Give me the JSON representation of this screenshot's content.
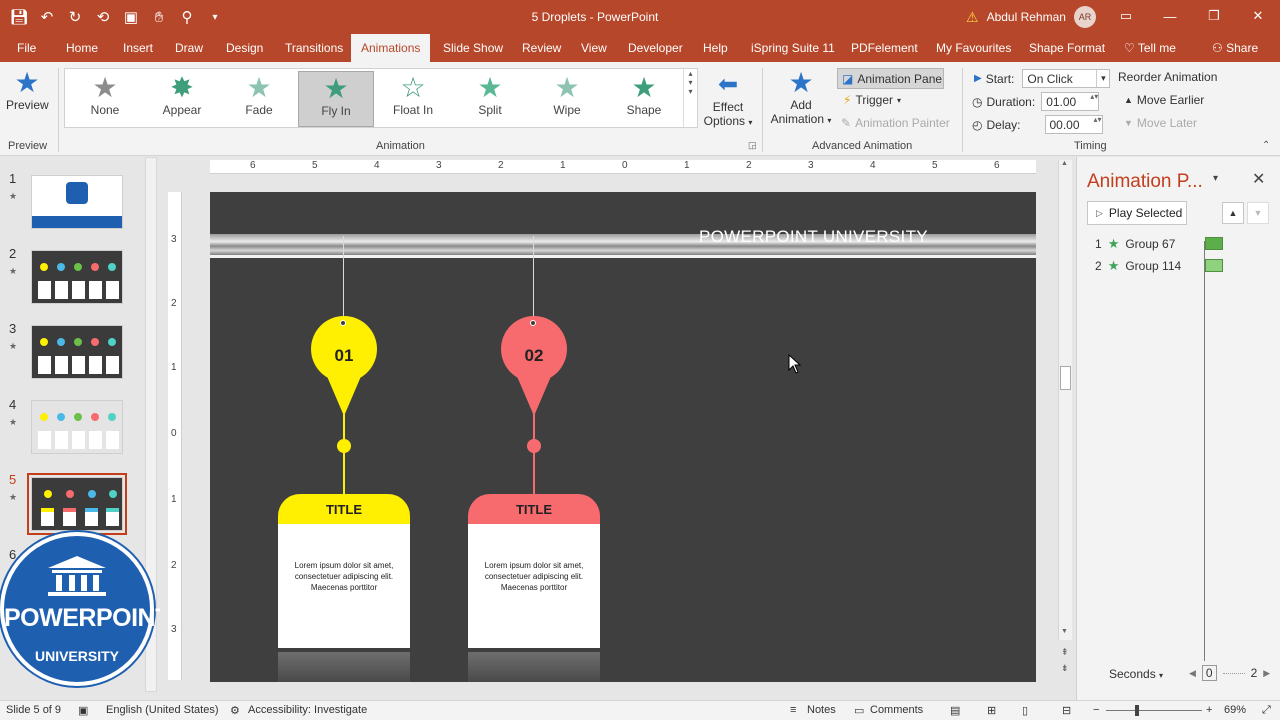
{
  "titlebar": {
    "doc_title": "5 Droplets  -  PowerPoint",
    "user_name": "Abdul Rehman",
    "avatar_initials": "AR"
  },
  "tabs": [
    "File",
    "Home",
    "Insert",
    "Draw",
    "Design",
    "Transitions",
    "Animations",
    "Slide Show",
    "Review",
    "View",
    "Developer",
    "Help",
    "iSpring Suite 11",
    "PDFelement",
    "My Favourites",
    "Shape Format",
    "Tell me",
    "Share"
  ],
  "active_tab": "Animations",
  "ribbon": {
    "preview": {
      "label": "Preview",
      "group": "Preview"
    },
    "animation_gallery": [
      {
        "label": "None",
        "color": "#8c8c8c"
      },
      {
        "label": "Appear",
        "color": "#3e9d7a"
      },
      {
        "label": "Fade",
        "color": "#8cc4b0"
      },
      {
        "label": "Fly In",
        "color": "#3e9d7a"
      },
      {
        "label": "Float In",
        "color": "#3e9d7a"
      },
      {
        "label": "Split",
        "color": "#5ab895"
      },
      {
        "label": "Wipe",
        "color": "#8cc4b0"
      },
      {
        "label": "Shape",
        "color": "#3e9d7a"
      }
    ],
    "selected_animation": "Fly In",
    "effect_options": {
      "line1": "Effect",
      "line2": "Options"
    },
    "animation_group": "Animation",
    "add_animation": {
      "line1": "Add",
      "line2": "Animation"
    },
    "animation_pane": "Animation Pane",
    "trigger": "Trigger",
    "animation_painter": "Animation Painter",
    "advanced_group": "Advanced Animation",
    "start_label": "Start:",
    "start_value": "On Click",
    "duration_label": "Duration:",
    "duration_value": "01.00",
    "delay_label": "Delay:",
    "delay_value": "00.00",
    "timing_group": "Timing",
    "reorder": "Reorder Animation",
    "move_earlier": "Move Earlier",
    "move_later": "Move Later"
  },
  "thumbnails": [
    {
      "num": "1",
      "star": "★"
    },
    {
      "num": "2",
      "star": "★"
    },
    {
      "num": "3",
      "star": "★"
    },
    {
      "num": "4",
      "star": "★"
    },
    {
      "num": "5",
      "star": "★"
    },
    {
      "num": "6",
      "star": ""
    }
  ],
  "logo": {
    "line1": "POWERPOINT",
    "line2": "UNIVERSITY"
  },
  "ruler": {
    "h": [
      "6",
      "5",
      "4",
      "3",
      "2",
      "1",
      "0",
      "1",
      "2",
      "3",
      "4",
      "5",
      "6"
    ],
    "v": [
      "3",
      "2",
      "1",
      "0",
      "1",
      "2",
      "3"
    ]
  },
  "slide": {
    "header": "POWERPOINT UNIVERSITY",
    "items": [
      {
        "num": "01",
        "title": "TITLE",
        "body": "Lorem ipsum dolor sit amet, consectetuer adipiscing elit. Maecenas porttitor",
        "color": "#ffef00"
      },
      {
        "num": "02",
        "title": "TITLE",
        "body": "Lorem ipsum dolor sit amet, consectetuer adipiscing elit. Maecenas porttitor",
        "color": "#f76b6e"
      }
    ]
  },
  "animation_pane": {
    "title": "Animation P...",
    "play_selected": "Play Selected",
    "items": [
      {
        "index": "1",
        "name": "Group 67",
        "bar_color": "#5cae4a"
      },
      {
        "index": "2",
        "name": "Group 114",
        "bar_color": "#8fd27d"
      }
    ],
    "seconds_label": "Seconds",
    "scale_start": "0",
    "scale_end": "2"
  },
  "status": {
    "slide_info": "Slide 5 of 9",
    "language": "English (United States)",
    "accessibility": "Accessibility: Investigate",
    "notes": "Notes",
    "comments": "Comments",
    "zoom": "69%"
  }
}
